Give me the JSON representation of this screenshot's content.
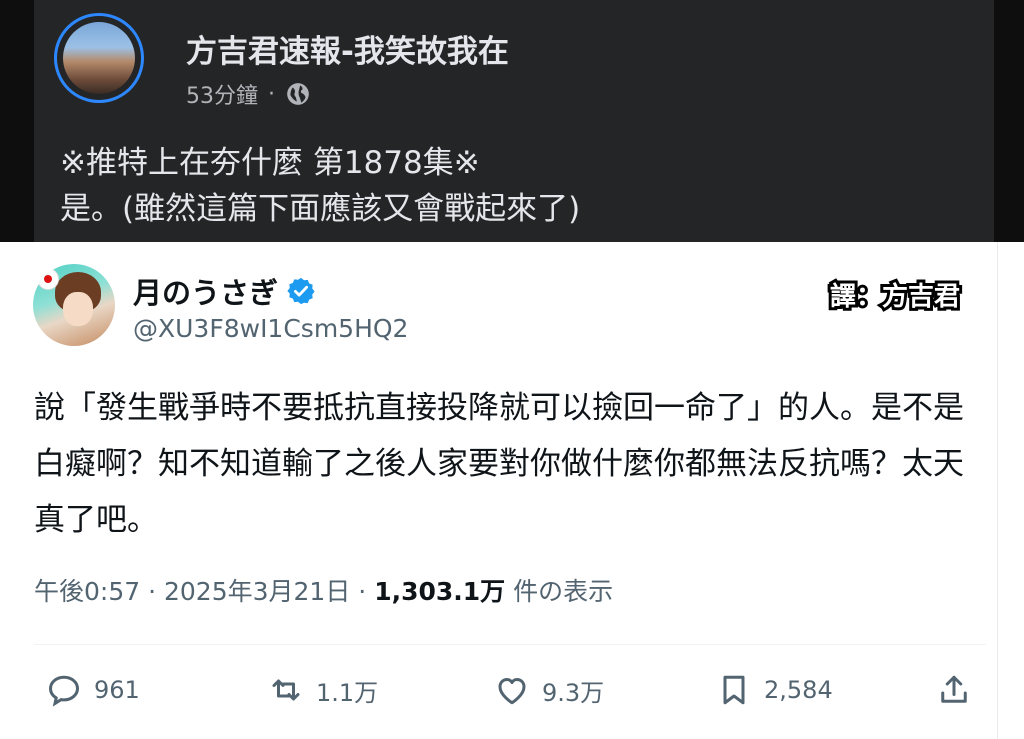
{
  "facebook": {
    "page_name": "方吉君速報-我笑故我在",
    "time": "53分鐘",
    "separator": "·",
    "post_line1": "※推特上在夯什麼 第1878集※",
    "post_line2": "是。(雖然這篇下面應該又會戰起來了)",
    "icons": {
      "privacy": "globe-icon",
      "avatar": "page-avatar"
    }
  },
  "tweet": {
    "name": "月のうさぎ",
    "handle": "@XU3F8wI1Csm5HQ2",
    "translator_label": "譯：方吉君",
    "body": "說「發生戰爭時不要抵抗直接投降就可以撿回一命了」的人。是不是白癡啊？知不知道輸了之後人家要對你做什麼你都無法反抗嗎？太天真了吧。",
    "time": "午後0:57",
    "date": "2025年3月21日",
    "views_count": "1,303.1万",
    "views_label": "件の表示",
    "dot": "·",
    "actions": {
      "reply": "961",
      "retweet": "1.1万",
      "like": "9.3万",
      "bookmark": "2,584"
    },
    "colors": {
      "verified": "#1d9bf0",
      "text": "#0f1419",
      "muted": "#536471"
    }
  }
}
